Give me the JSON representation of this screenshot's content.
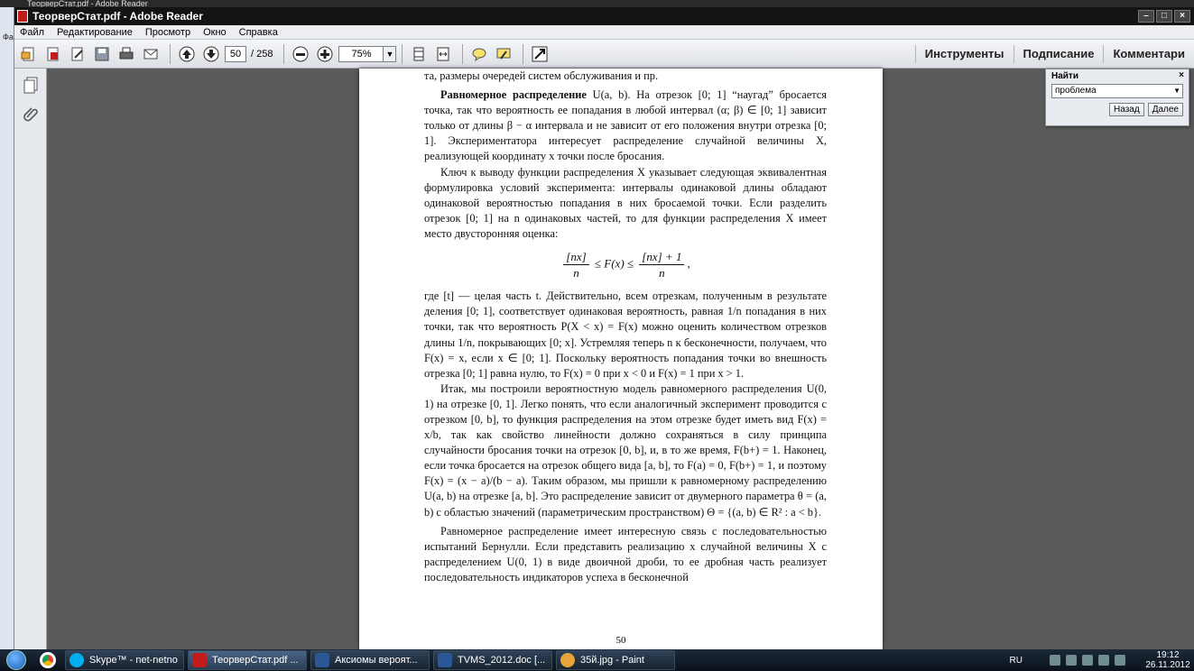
{
  "background_window": {
    "title": "ТеорверСтат.pdf - Adobe Reader",
    "side_label": "Фа"
  },
  "window": {
    "title": "ТеорверСтат.pdf - Adobe Reader"
  },
  "menu": [
    "Файл",
    "Редактирование",
    "Просмотр",
    "Окно",
    "Справка"
  ],
  "toolbar": {
    "page_current": "50",
    "page_total": "/ 258",
    "zoom": "75%",
    "right_links": [
      "Инструменты",
      "Подписание",
      "Комментари"
    ]
  },
  "find": {
    "title": "Найти",
    "query": "проблема",
    "back_label": "Назад",
    "next_label": "Далее"
  },
  "page": {
    "number": "50",
    "top_line": "та, размеры очередей систем обслуживания и пр.",
    "heading": "Равномерное распределение",
    "p1_rest": " U(a, b). На отрезок [0; 1] “наугад” бросается точка, так что вероятность ее попадания в любой интервал (α; β) ∈ [0; 1] зависит только от длины β − α интервала и не зависит от его положения внутри отрезка [0; 1]. Экспериментатора интересует распределение случайной величины X, реализующей координату x точки после бросания.",
    "p2": "Ключ к выводу функции распределения X указывает следующая эквивалентная формулировка условий эксперимента: интервалы одинаковой длины обладают одинаковой вероятностью попадания в них бросаемой точки. Если разделить отрезок [0; 1] на n одинаковых частей, то для функции распределения X имеет место двусторонняя оценка:",
    "formula_num1": "[nx]",
    "formula_den": "n",
    "formula_mid": "≤ F(x) ≤",
    "formula_num2": "[nx] + 1",
    "formula_end": ",",
    "p3": "где [t] — целая часть t. Действительно, всем отрезкам, полученным в результате деления [0; 1], соответствует одинаковая вероятность, равная 1/n попадания в них точки, так что вероятность P(X < x) = F(x) можно оценить количеством отрезков длины 1/n, покрывающих [0; x]. Устремляя теперь n к бесконечности, получаем, что F(x) = x, если x ∈ [0; 1]. Поскольку вероятность попадания точки во внешность отрезка [0; 1] равна нулю, то F(x) = 0 при x < 0 и F(x) = 1 при x > 1.",
    "p4": "Итак, мы построили вероятностную модель равномерного распределения U(0, 1) на отрезке [0, 1]. Легко понять, что если аналогичный эксперимент проводится с отрезком [0, b], то функция распределения на этом отрезке будет иметь вид F(x) = x/b, так как свойство линейности должно сохраняться в силу принципа случайности бросания точки на отрезок [0, b], и, в то же время, F(b+) = 1. Наконец, если точка бросается на отрезок общего вида [a, b], то F(a) = 0, F(b+) = 1, и поэтому F(x) = (x − a)/(b − a). Таким образом, мы пришли к равномерному распределению U(a, b) на отрезке [a, b]. Это распределение зависит от двумерного параметра θ = (a, b) с областью значений (параметрическим пространством) Θ = {(a, b) ∈ R² : a < b}.",
    "p5": "Равномерное распределение имеет интересную связь с последовательностью испытаний Бернулли. Если представить реализацию x случайной величины X с распределением U(0, 1) в виде двоичной дроби, то ее дробная часть реализует последовательность индикаторов успеха в бесконечной"
  },
  "taskbar": {
    "tasks": [
      "Skype™ - net-netno",
      "ТеорверСтат.pdf ...",
      "Аксиомы вероят...",
      "TVMS_2012.doc [...",
      "35й.jpg - Paint"
    ],
    "lang": "RU",
    "time": "19:12",
    "date": "26.11.2012"
  },
  "colors": {
    "doc_bg": "#5a5a5a",
    "titlebar": "#141414",
    "taskbar": "#0b121b"
  }
}
